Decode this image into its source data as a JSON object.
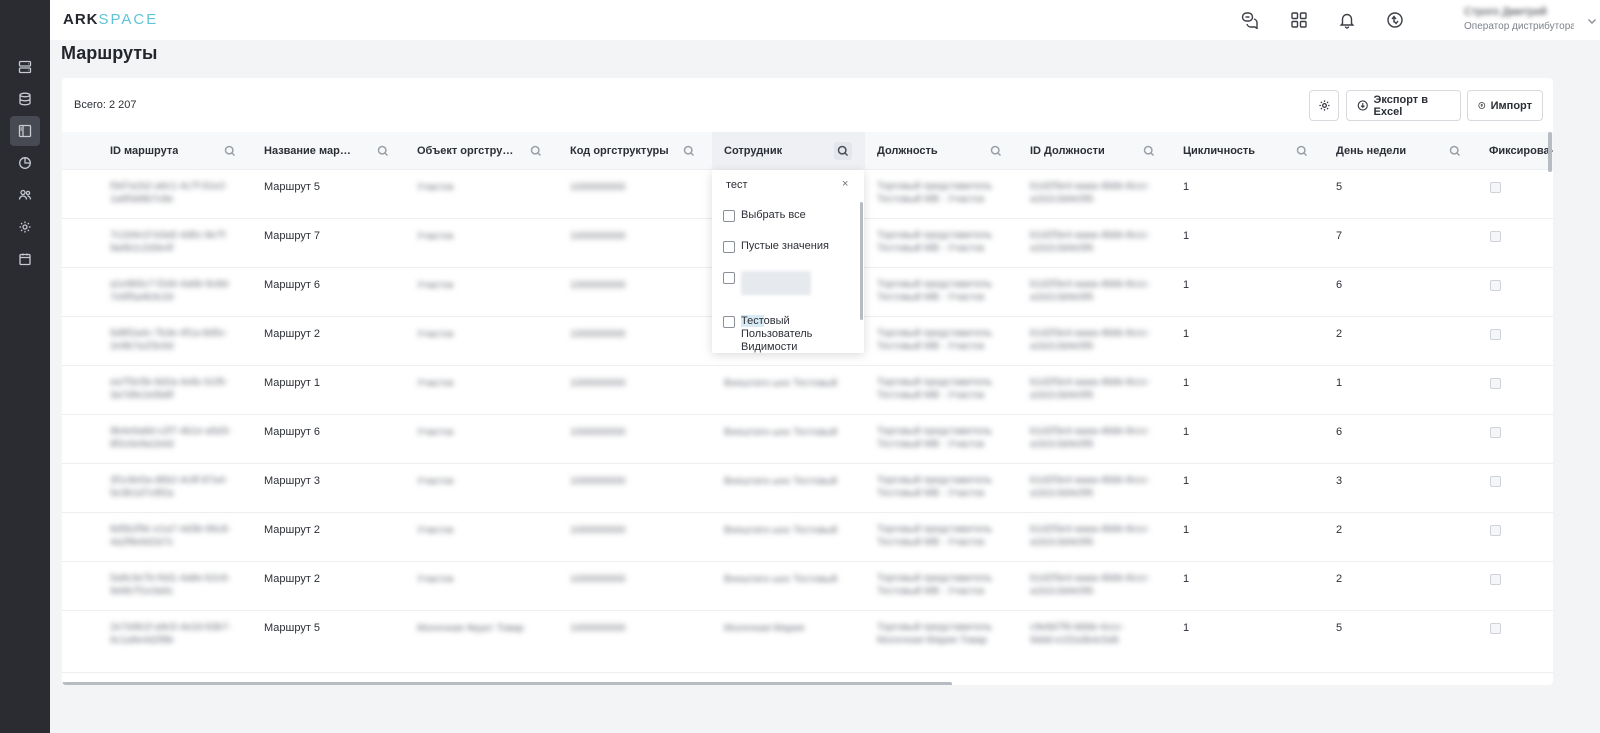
{
  "app": {
    "logo_ark": "ARK",
    "logo_space": "SPACE",
    "user_name": "Строго Дмитрий",
    "user_role": "Оператор дистрибутора"
  },
  "page": {
    "title": "Маршруты",
    "total": "Всего: 2 207",
    "export_label": "Экспорт в Excel",
    "import_label": "Импорт"
  },
  "columns": [
    {
      "label": "ID маршрута"
    },
    {
      "label": "Название маршрута"
    },
    {
      "label": "Объект оргструктуры"
    },
    {
      "label": "Код оргструктуры"
    },
    {
      "label": "Сотрудник"
    },
    {
      "label": "Должность"
    },
    {
      "label": "ID Должности"
    },
    {
      "label": "Цикличность"
    },
    {
      "label": "День недели"
    },
    {
      "label": "Фиксированный"
    }
  ],
  "rows": [
    {
      "id": "f3d7a1b2-a6c1-4c7f-91e2-1a9f3d6b7c8e",
      "name": "Маршрут 5",
      "org": "Участок",
      "code": "1000000000",
      "employee": "",
      "position": "Торговый представитель Тестовый МВ - Участок",
      "pos_id": "b1d2f3e4-aaaa-4bbb-8ccc-a1b2c3d4e5f6",
      "cycle": "1",
      "day": "5"
    },
    {
      "id": "7c2d4e1f-b3a5-4d6c-8e7f-9a0b1c2d3e4f",
      "name": "Маршрут 7",
      "org": "Участок",
      "code": "1000000000",
      "employee": "",
      "position": "Торговый представитель Тестовый МВ - Участок",
      "pos_id": "b1d2f3e4-aaaa-4bbb-8ccc-a1b2c3d4e5f6",
      "cycle": "1",
      "day": "7"
    },
    {
      "id": "a1e9b5c7-f2d4-4a6b-9c8d-7e6f5a4b3c2d",
      "name": "Маршрут 6",
      "org": "Участок",
      "code": "1000000000",
      "employee": "",
      "position": "Торговый представитель Тестовый МВ - Участок",
      "pos_id": "b1d2f3e4-aaaa-4bbb-8ccc-a1b2c3d4e5f6",
      "cycle": "1",
      "day": "6"
    },
    {
      "id": "6d8f2a4c-7b3e-4f1a-8d5c-2e9b7a1f3c6d",
      "name": "Маршрут 2",
      "org": "Участок",
      "code": "1000000000",
      "employee": "",
      "position": "Торговый представитель Тестовый МВ - Участок",
      "pos_id": "b1d2f3e4-aaaa-4bbb-8ccc-a1b2c3d4e5f6",
      "cycle": "1",
      "day": "2"
    },
    {
      "id": "ea7f3c5b-9d2a-4e8c-b1f6-3a7d9c2e5b8f",
      "name": "Маршрут 1",
      "org": "Участок",
      "code": "1000000000",
      "employee": "Внештатн ынх Тестовый",
      "position": "Торговый представитель Тестовый МВ - Участок",
      "pos_id": "b1d2f3e4-aaaa-4bbb-8ccc-a1b2c3d4e5f6",
      "cycle": "1",
      "day": "1"
    },
    {
      "id": "9b4e6a8d-c2f7-4b1e-a5d3-8f2c6e9a1b4d",
      "name": "Маршрут 6",
      "org": "Участок",
      "code": "1000000000",
      "employee": "Внештатн ынх Тестовый",
      "position": "Торговый представитель Тестовый МВ - Участок",
      "pos_id": "b1d2f3e4-aaaa-4bbb-8ccc-a1b2c3d4e5f6",
      "cycle": "1",
      "day": "6"
    },
    {
      "id": "3f1c8e5a-d6b2-4c9f-87a4-5e3b1d7c9f2a",
      "name": "Маршрут 3",
      "org": "Участок",
      "code": "1000000000",
      "employee": "Внештатн ынх Тестовый",
      "position": "Торговый представитель Тестовый МВ - Участок",
      "pos_id": "b1d2f3e4-aaaa-4bbb-8ccc-a1b2c3d4e5f6",
      "cycle": "1",
      "day": "3"
    },
    {
      "id": "8d5b2f9c-e1a7-4d3b-96c8-4a2f8e6d1b7c",
      "name": "Маршрут 2",
      "org": "Участок",
      "code": "1000000000",
      "employee": "Внештатн ынх Тестовый",
      "position": "Торговый представитель Тестовый МВ - Участок",
      "pos_id": "b1d2f3e4-aaaa-4bbb-8ccc-a1b2c3d4e5f6",
      "cycle": "1",
      "day": "2"
    },
    {
      "id": "5a9c3e7b-f4d1-4a8e-b2c6-9d4b7f1e3a5c",
      "name": "Маршрут 2",
      "org": "Участок",
      "code": "1000000000",
      "employee": "Внештатн ынх Тестовый",
      "position": "Торговый представитель Тестовый МВ - Участок",
      "pos_id": "b1d2f3e4-aaaa-4bbb-8ccc-a1b2c3d4e5f6",
      "cycle": "1",
      "day": "2"
    },
    {
      "id": "2e7d4b1f-a9c5-4e2d-83b7-6c1a9e4d2f8b",
      "name": "Маршрут 5",
      "org": "Молочная Фрукт Товар",
      "code": "1000000000",
      "employee": "Молочная Мария",
      "position": "Торговый представитель Молочная Мария Товар",
      "pos_id": "c9e8d7f6-bbbb-4ccc-9ddd-e1f2a3b4c5d6",
      "cycle": "1",
      "day": "5"
    }
  ],
  "filter": {
    "search_value": "тест",
    "clear_symbol": "×",
    "select_all": "Выбрать все",
    "empty_values": "Пустые значения",
    "option_hl": "Тест",
    "option_rest": "овый Пользователь Видимости"
  }
}
